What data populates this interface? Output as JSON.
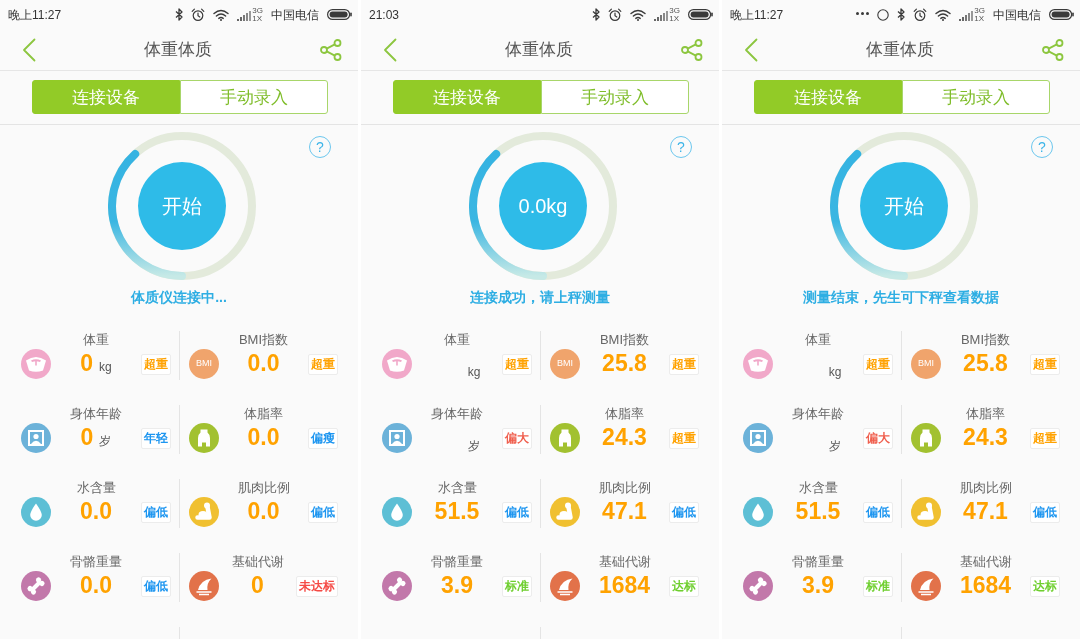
{
  "screens": [
    {
      "status_bar": {
        "time": "晚上11:27",
        "icons": [
          {
            "kind": "bluetooth"
          },
          {
            "kind": "alarm"
          },
          {
            "kind": "wifi"
          },
          {
            "kind": "signal",
            "network_top": "3G",
            "network_bottom": "1X"
          }
        ],
        "carrier": "中国电信"
      },
      "nav": {
        "title": "体重体质"
      },
      "tabs": [
        {
          "label": "连接设备",
          "selected": true
        },
        {
          "label": "手动录入",
          "selected": false
        }
      ],
      "help_button": "?",
      "measure_button": "开始",
      "message": "体质仪连接中...",
      "metrics": [
        {
          "label": "体重",
          "value": "0",
          "unit": "kg",
          "status": {
            "text": "超重",
            "color": "#ffa200"
          }
        },
        {
          "label": "BMI指数",
          "icon_label": "BMI",
          "value": "0.0",
          "status": {
            "text": "超重",
            "color": "#ffa200"
          }
        },
        {
          "label": "身体年龄",
          "value": "0",
          "unit": "岁",
          "status": {
            "text": "年轻",
            "color": "#1e96f0"
          }
        },
        {
          "label": "体脂率",
          "value": "0.0",
          "status": {
            "text": "偏瘦",
            "color": "#1e96f0"
          }
        },
        {
          "label": "水含量",
          "value": "0.0",
          "status": {
            "text": "偏低",
            "color": "#1e96f0"
          }
        },
        {
          "label": "肌肉比例",
          "value": "0.0",
          "status": {
            "text": "偏低",
            "color": "#1e96f0"
          }
        },
        {
          "label": "骨骼重量",
          "value": "0.0",
          "status": {
            "text": "偏低",
            "color": "#1e96f0"
          }
        },
        {
          "label": "基础代谢",
          "value": "0",
          "status": {
            "text": "未达标",
            "color": "#f54a45"
          }
        }
      ]
    },
    {
      "status_bar": {
        "time": "21:03",
        "icons": [
          {
            "kind": "bluetooth"
          },
          {
            "kind": "alarm"
          },
          {
            "kind": "wifi"
          },
          {
            "kind": "signal",
            "network_top": "3G",
            "network_bottom": "1X"
          }
        ]
      },
      "nav": {
        "title": "体重体质"
      },
      "tabs": [
        {
          "label": "连接设备",
          "selected": true
        },
        {
          "label": "手动录入",
          "selected": false
        }
      ],
      "help_button": "?",
      "measure_button": "0.0kg",
      "message": "连接成功，请上秤测量",
      "metrics": [
        {
          "label": "体重",
          "unit": "kg",
          "status": {
            "text": "超重",
            "color": "#ffa200"
          }
        },
        {
          "label": "BMI指数",
          "icon_label": "BMI",
          "value": "25.8",
          "status": {
            "text": "超重",
            "color": "#ffa200"
          }
        },
        {
          "label": "身体年龄",
          "unit": "岁",
          "status": {
            "text": "偏大",
            "color": "#f0604f"
          }
        },
        {
          "label": "体脂率",
          "value": "24.3",
          "status": {
            "text": "超重",
            "color": "#ffa200"
          }
        },
        {
          "label": "水含量",
          "value": "51.5",
          "status": {
            "text": "偏低",
            "color": "#1e96f0"
          }
        },
        {
          "label": "肌肉比例",
          "value": "47.1",
          "status": {
            "text": "偏低",
            "color": "#1e96f0"
          }
        },
        {
          "label": "骨骼重量",
          "value": "3.9",
          "status": {
            "text": "标准",
            "color": "#6fcf2f"
          }
        },
        {
          "label": "基础代谢",
          "value": "1684",
          "status": {
            "text": "达标",
            "color": "#6fcf2f"
          }
        }
      ]
    },
    {
      "status_bar": {
        "time": "晚上11:27",
        "icons": [
          {
            "kind": "dots"
          },
          {
            "kind": "circle"
          },
          {
            "kind": "bluetooth"
          },
          {
            "kind": "alarm"
          },
          {
            "kind": "wifi"
          },
          {
            "kind": "signal",
            "network_top": "3G",
            "network_bottom": "1X"
          }
        ],
        "carrier": "中国电信"
      },
      "nav": {
        "title": "体重体质"
      },
      "tabs": [
        {
          "label": "连接设备",
          "selected": true
        },
        {
          "label": "手动录入",
          "selected": false
        }
      ],
      "help_button": "?",
      "measure_button": "开始",
      "message": "测量结束，先生可下秤查看数据",
      "metrics": [
        {
          "label": "体重",
          "unit": "kg",
          "status": {
            "text": "超重",
            "color": "#ffa200"
          }
        },
        {
          "label": "BMI指数",
          "icon_label": "BMI",
          "value": "25.8",
          "status": {
            "text": "超重",
            "color": "#ffa200"
          }
        },
        {
          "label": "身体年龄",
          "unit": "岁",
          "status": {
            "text": "偏大",
            "color": "#f0604f"
          }
        },
        {
          "label": "体脂率",
          "value": "24.3",
          "status": {
            "text": "超重",
            "color": "#ffa200"
          }
        },
        {
          "label": "水含量",
          "value": "51.5",
          "status": {
            "text": "偏低",
            "color": "#1e96f0"
          }
        },
        {
          "label": "肌肉比例",
          "value": "47.1",
          "status": {
            "text": "偏低",
            "color": "#1e96f0"
          }
        },
        {
          "label": "骨骼重量",
          "value": "3.9",
          "status": {
            "text": "标准",
            "color": "#6fcf2f"
          }
        },
        {
          "label": "基础代谢",
          "value": "1684",
          "status": {
            "text": "达标",
            "color": "#6fcf2f"
          }
        }
      ]
    }
  ]
}
